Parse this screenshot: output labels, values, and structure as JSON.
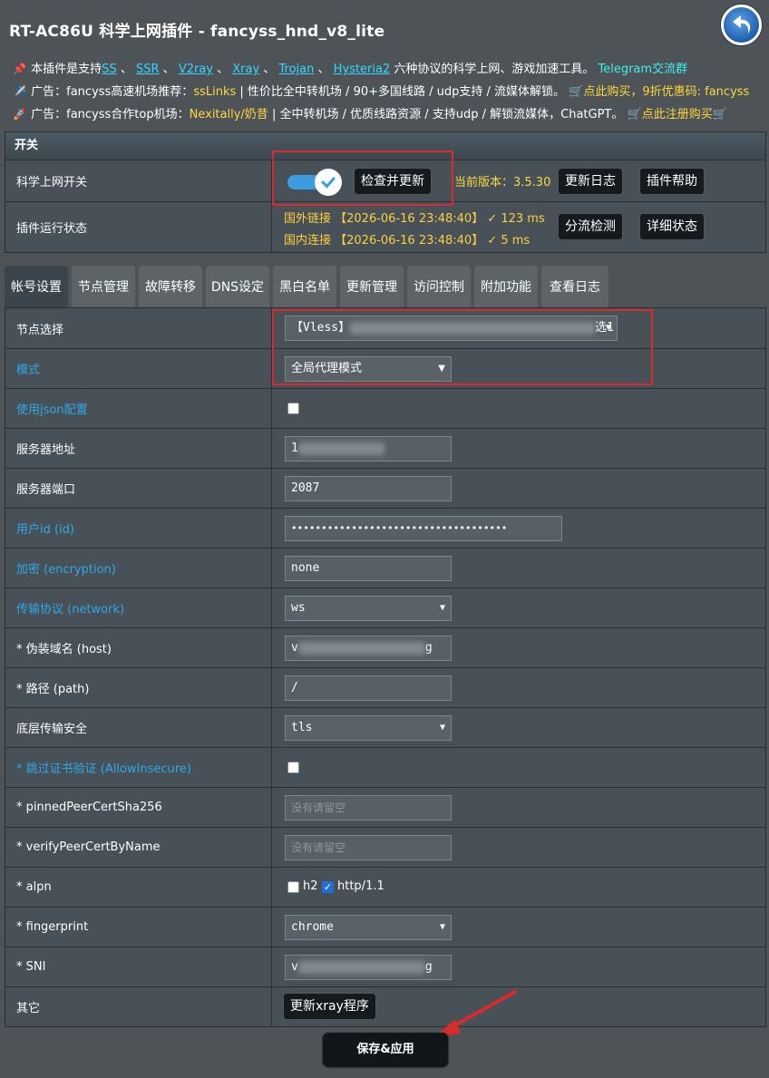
{
  "header": {
    "title": "RT-AC86U 科学上网插件 - fancyss_hnd_v8_lite"
  },
  "info": {
    "line1_prefix": "本插件是支持",
    "protocols": [
      "SS",
      "SSR",
      "V2ray",
      "Xray",
      "Trojan",
      "Hysteria2"
    ],
    "separator": "、",
    "line1_suffix": "六种协议的科学上网、游戏加速工具。",
    "line1_link": "Telegram交流群",
    "line2_prefix": "广告：fancyss高速机场推荐：",
    "line2_brand": "ssLinks",
    "line2_text": "| 性价比全中转机场 / 90+多国线路 / udp支持 / 流媒体解锁。",
    "line2_cta": "点此购买，9折优惠码: fancyss",
    "line3_prefix": "广告：fancyss合作top机场：",
    "line3_brand": "Nexitally/奶昔",
    "line3_text": "| 全中转机场 / 优质线路资源 / 支持udp / 解锁流媒体，ChatGPT。",
    "line3_cta": "点此注册购买"
  },
  "switch_section": {
    "header": "开关",
    "switch_label": "科学上网开关",
    "switch_on": true,
    "check_update_button": "检查并更新",
    "version_text": "当前版本：3.5.30",
    "changelog_button": "更新日志",
    "help_button": "插件帮助",
    "status_label": "插件运行状态",
    "status_foreign": "国外链接 【2026-06-16 23:48:40】 ✓  123 ms",
    "status_domestic": "国内连接 【2026-06-16 23:48:40】 ✓  5 ms",
    "split_check_button": "分流检测",
    "detail_status_button": "详细状态"
  },
  "tabs": [
    "帐号设置",
    "节点管理",
    "故障转移",
    "DNS设定",
    "黑白名单",
    "更新管理",
    "访问控制",
    "附加功能",
    "查看日志"
  ],
  "form": {
    "node_label": "节点选择",
    "node_value_prefix": "【Vless】",
    "node_value_suffix": "选1",
    "mode_label": "模式",
    "mode_value": "全局代理模式",
    "json_label": "使用json配置",
    "json_checked": false,
    "server_label": "服务器地址",
    "server_value": "1",
    "port_label": "服务器端口",
    "port_value": "2087",
    "uuid_label": "用户id (id)",
    "uuid_value": "••••••••••••••••••••••••••••••••••••",
    "encryption_label": "加密 (encryption)",
    "encryption_value": "none",
    "network_label": "传输协议 (network)",
    "network_value": "ws",
    "host_label": "* 伪装域名 (host)",
    "host_prefix": "v",
    "host_suffix": "g",
    "path_label": "* 路径 (path)",
    "path_value": "/",
    "security_label": "底层传输安全",
    "security_value": "tls",
    "insecure_label": "* 跳过证书验证 (AllowInsecure)",
    "insecure_checked": false,
    "pinned_label": "* pinnedPeerCertSha256",
    "pinned_placeholder": "没有请留空",
    "verify_label": "* verifyPeerCertByName",
    "verify_placeholder": "没有请留空",
    "alpn_label": "* alpn",
    "alpn_h2": "h2",
    "alpn_h2_checked": false,
    "alpn_http11": "http/1.1",
    "alpn_http11_checked": true,
    "fingerprint_label": "* fingerprint",
    "fingerprint_value": "chrome",
    "sni_label": "* SNI",
    "sni_prefix": "v",
    "sni_suffix": "g",
    "other_label": "其它",
    "update_xray_button": "更新xray程序"
  },
  "save_button": "保存&应用",
  "colors": {
    "background": "#4d5357",
    "link_blue": "#2fa8e8",
    "highlight_yellow": "#ffd93c",
    "annotation_red": "#d92b2b"
  }
}
